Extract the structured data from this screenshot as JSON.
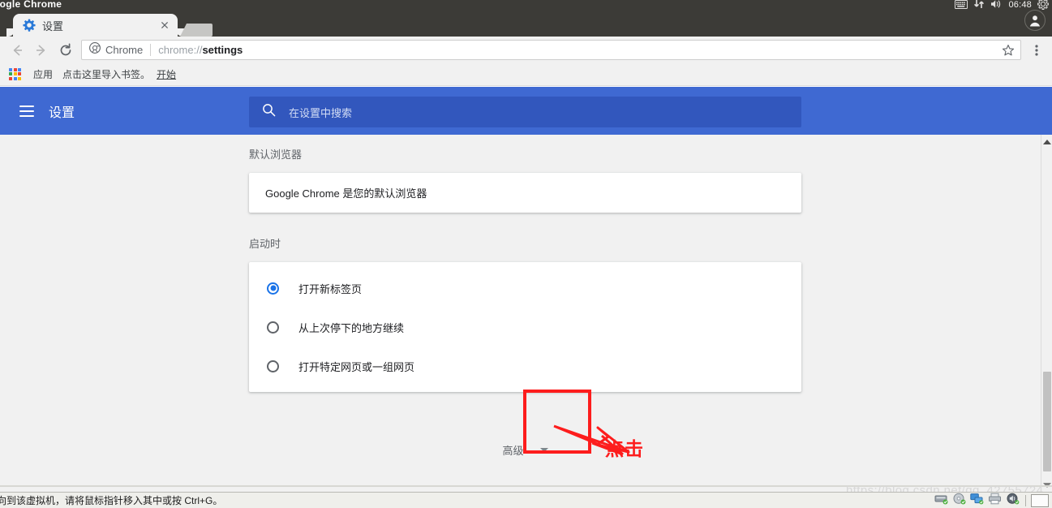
{
  "os": {
    "window_title": "oogle Chrome",
    "tray": {
      "keyboard_icon": "keyboard-icon",
      "network_icon": "network-updown-icon",
      "volume_icon": "volume-icon",
      "clock": "06:48",
      "settings_icon": "gear-icon"
    }
  },
  "browser": {
    "tab": {
      "favicon": "settings-gear-favicon",
      "title": "设置",
      "close_icon": "close-icon"
    },
    "new_tab_button": "new-tab-button",
    "nav": {
      "back_icon": "arrow-left-icon",
      "forward_icon": "arrow-right-icon",
      "reload_icon": "reload-icon"
    },
    "omnibox": {
      "chrome_badge_icon": "chrome-logo-icon",
      "chrome_badge_label": "Chrome",
      "url_prefix": "chrome://",
      "url_bold": "settings",
      "bookmark_star_icon": "star-icon"
    },
    "menu_icon": "three-dot-menu-icon",
    "profile_icon": "profile-avatar-icon",
    "bookmarks_bar": {
      "apps_icon": "apps-grid-icon",
      "apps_label": "应用",
      "import_hint": "点击这里导入书签。",
      "start_link": "开始"
    }
  },
  "settings": {
    "header": {
      "menu_icon": "hamburger-menu-icon",
      "title": "设置",
      "search_icon": "search-icon",
      "search_placeholder": "在设置中搜索",
      "search_value": ""
    },
    "sections": {
      "default_browser": {
        "title": "默认浏览器",
        "status": "Google Chrome 是您的默认浏览器"
      },
      "on_startup": {
        "title": "启动时",
        "options": [
          {
            "label": "打开新标签页",
            "selected": true
          },
          {
            "label": "从上次停下的地方继续",
            "selected": false
          },
          {
            "label": "打开特定网页或一组网页",
            "selected": false
          }
        ]
      },
      "advanced": {
        "label": "高级",
        "expand_icon": "chevron-down-icon"
      }
    },
    "scrollbar": {
      "up_icon": "scroll-up-arrow-icon",
      "down_icon": "scroll-down-arrow-icon"
    }
  },
  "annotation": {
    "highlight_box": "red-highlight-rectangle",
    "arrow": "red-arrow",
    "callout_text": "点击",
    "color": "#fd1d1d"
  },
  "vmware": {
    "status_text": "向到该虚拟机，请将鼠标指针移入其中或按 Ctrl+G。",
    "devices": [
      "hard-disk-icon",
      "cd-dvd-icon",
      "network-adapter-icon",
      "printer-icon",
      "sound-card-icon"
    ],
    "watermark": "https://blog.csdn.net/qq_42755724"
  },
  "colors": {
    "settings_header_blue": "#3f69d2",
    "search_field_blue": "#3257bd",
    "radio_selected": "#1a73e8",
    "annotation_red": "#fd1d1d",
    "chrome_chrome_gray": "#f1f1f1",
    "os_bar": "#3c3b37"
  }
}
